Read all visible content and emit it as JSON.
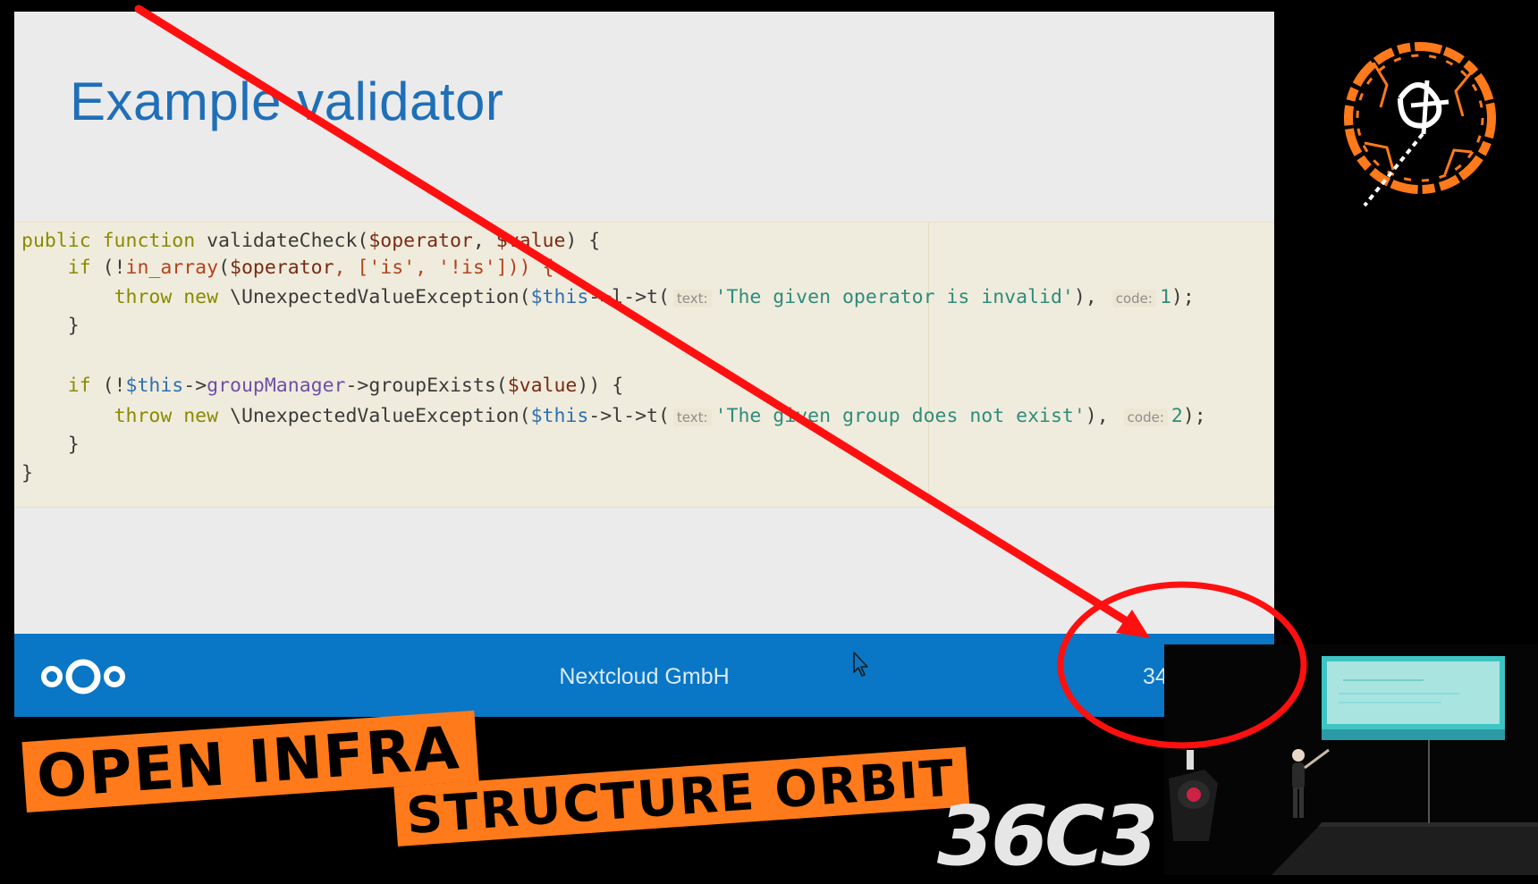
{
  "slide": {
    "title": "Example validator",
    "code": {
      "l1": {
        "kw": "public function",
        "name": " validateCheck(",
        "v1": "$operator",
        "sep": ", ",
        "v2": "$value",
        "end": ") {"
      },
      "l2": {
        "pre": "    ",
        "kw": "if",
        "open": " (!",
        "fn": "in_array",
        "p": "(",
        "v": "$operator",
        "arr": ", ['is', '!is'])) {"
      },
      "l3": {
        "pre": "        ",
        "kw": "throw new",
        "cls": " \\UnexpectedValueException(",
        "this": "$this",
        "call": "->l->t(",
        "hint1": "text:",
        "str": "'The given operator is invalid'",
        "mid": "), ",
        "hint2": "code:",
        "num": "1",
        "end": ");"
      },
      "l4": "    }",
      "l5": {
        "pre": "    ",
        "kw": "if",
        "open": " (!",
        "this": "$this",
        "arrow": "->",
        "prop": "groupManager",
        "call": "->groupExists(",
        "v": "$value",
        "end": ")) {"
      },
      "l6": {
        "pre": "        ",
        "kw": "throw new",
        "cls": " \\UnexpectedValueException(",
        "this": "$this",
        "call": "->l->t(",
        "hint1": "text:",
        "str": "'The given group does not exist'",
        "mid": "), ",
        "hint2": "code:",
        "num": "2",
        "end": ");"
      },
      "l7": "    }",
      "l8": "}"
    },
    "footer": {
      "company": "Nextcloud GmbH",
      "page_number": "34"
    }
  },
  "banner": {
    "line1": "Open Infra",
    "line2": "Structure Orbit"
  },
  "event": {
    "logo_text": "36C3"
  },
  "colors": {
    "title": "#1f6fb8",
    "footer": "#0a76c6",
    "banner": "#ff7a1a",
    "annotation": "#ff1010"
  },
  "icons": [
    "nextcloud-logo-icon",
    "mouse-cursor-icon",
    "conference-logo-icon",
    "annotation-arrow",
    "annotation-circle"
  ]
}
